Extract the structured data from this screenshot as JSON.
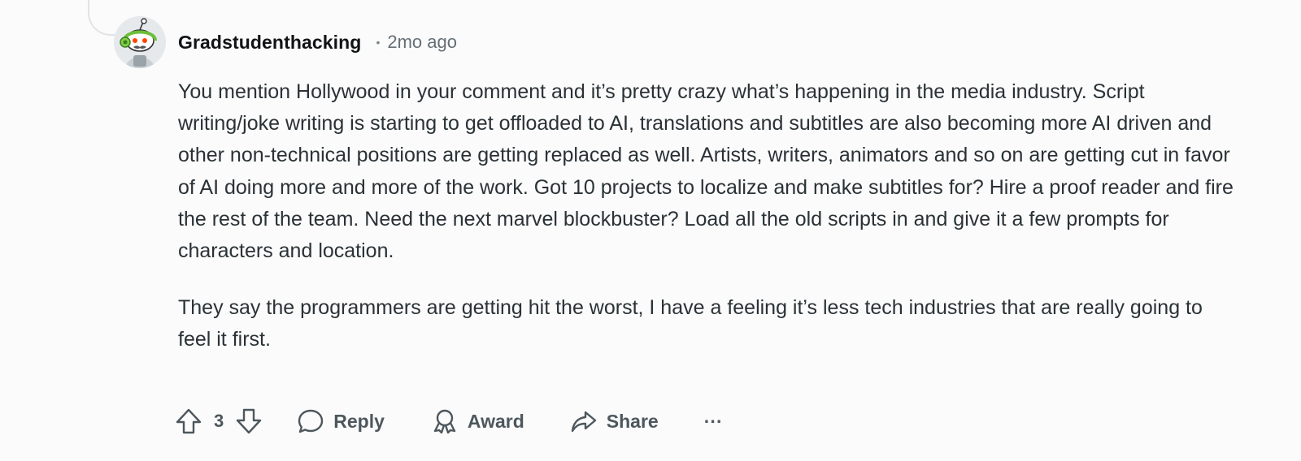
{
  "comment": {
    "author": "Gradstudenthacking",
    "separator": "•",
    "timestamp": "2mo ago",
    "paragraphs": [
      "You mention Hollywood in your comment and it’s pretty crazy what’s happening in the media industry. Script writing/joke writing is starting to get offloaded to AI, translations and subtitles are also becoming more AI driven and other non-technical positions are getting replaced as well. Artists, writers, animators and so on are getting cut in favor of AI doing more and more of the work. Got 10 projects to localize and make subtitles for? Hire a proof reader and fire the rest of the team. Need the next marvel blockbuster? Load all the old scripts in and give it a few prompts for characters and location.",
      "They say the programmers are getting hit the worst, I have a feeling it’s less tech industries that are really going to feel it first."
    ]
  },
  "actions": {
    "vote_count": "3",
    "reply_label": "Reply",
    "award_label": "Award",
    "share_label": "Share",
    "more_label": "···"
  },
  "icons": {
    "upvote": "upvote-arrow-icon",
    "downvote": "downvote-arrow-icon",
    "reply": "speech-bubble-icon",
    "award": "award-ribbon-icon",
    "share": "share-arrow-icon",
    "more": "ellipsis-icon"
  },
  "colors": {
    "background": "#fbfbfb",
    "author": "#111416",
    "body_text": "#2a3236",
    "meta": "#646f76",
    "action": "#4d575d"
  }
}
